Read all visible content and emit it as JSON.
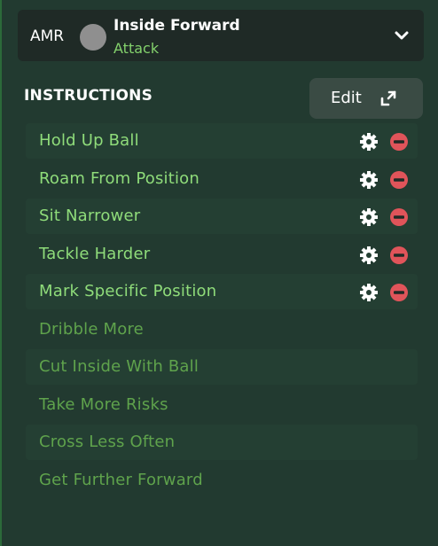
{
  "role": {
    "position_code": "AMR",
    "name": "Inside Forward",
    "duty": "Attack",
    "expand_icon": "chevron-down-icon"
  },
  "instructions": {
    "title": "INSTRUCTIONS",
    "edit_label": "Edit",
    "edit_icon": "expand-icon",
    "items": [
      {
        "label": "Hold Up Ball",
        "selected": true
      },
      {
        "label": "Roam From Position",
        "selected": true
      },
      {
        "label": "Sit Narrower",
        "selected": true
      },
      {
        "label": "Tackle Harder",
        "selected": true
      },
      {
        "label": "Mark Specific Position",
        "selected": true
      },
      {
        "label": "Dribble More",
        "selected": false
      },
      {
        "label": "Cut Inside With Ball",
        "selected": false
      },
      {
        "label": "Take More Risks",
        "selected": false
      },
      {
        "label": "Cross Less Often",
        "selected": false
      },
      {
        "label": "Get Further Forward",
        "selected": false
      }
    ]
  },
  "colors": {
    "background": "#223a30",
    "selected_text": "#8fdc7a",
    "unselected_text": "#5fa34c",
    "remove_icon": "#e0545a"
  }
}
